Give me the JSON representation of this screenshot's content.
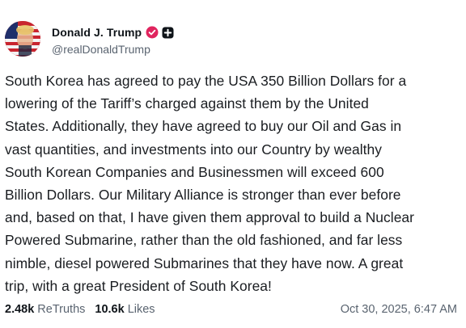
{
  "author": {
    "display_name": "Donald J. Trump",
    "handle": "@realDonaldTrump",
    "avatar_icon": "flag-portrait-avatar",
    "verified_icon": "verified-badge-icon",
    "verified_color": "#e0245e",
    "plus_icon": "plus-badge-icon"
  },
  "post": {
    "text": "South Korea has agreed to pay the USA 350 Billion Dollars for a\nlowering of the Tariff’s charged against them by the United\nStates. Additionally, they have agreed to buy our Oil and Gas in\nvast quantities, and investments into our Country by wealthy\nSouth Korean Companies and Businessmen will exceed 600\nBillion Dollars. Our Military Alliance is stronger than ever before\nand, based on that, I have given them approval to build a Nuclear\nPowered Submarine, rather than the old fashioned, and far less\nnimble, diesel powered Submarines that they have now. A great\ntrip, with a great President of South Korea!"
  },
  "stats": {
    "retruths_count": "2.48k",
    "retruths_label": "ReTruths",
    "likes_count": "10.6k",
    "likes_label": "Likes"
  },
  "timestamp": "Oct 30, 2025, 6:47 AM"
}
